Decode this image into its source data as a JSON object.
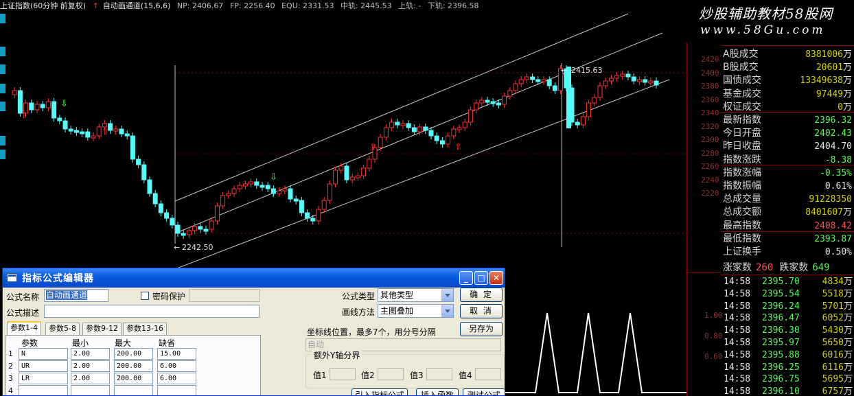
{
  "topbar": {
    "title": "上证指数(60分钟 前复权)",
    "indicator": "自动画通道(15,6,6)",
    "np": "NP: 2406.67",
    "fp": "FP: 2256.40",
    "equ": "EQU: 2331.53",
    "mid": "中轨: 2445.53",
    "upper": "上轨: -",
    "lower": "下轨: 2396.58"
  },
  "watermark": {
    "line1": "炒股辅助教材58股网",
    "line2": "www.58Gu.com"
  },
  "chart": {
    "price_high_label": "2415.63",
    "price_low_label": "2242.50",
    "colors": {
      "up": "#ff3232",
      "down": "#54fcfc",
      "channel": "#c8c8c8",
      "grid": "#8b0000"
    }
  },
  "yaxis": {
    "ticks": [
      "2420",
      "2400",
      "2380",
      "2360",
      "2340",
      "2320",
      "2300",
      "2280",
      "2260",
      "2240",
      "2220"
    ],
    "sub_ticks": [
      "1.00",
      "0.80",
      "0.60"
    ]
  },
  "stats": [
    {
      "label": "A股成交",
      "value": "8381006",
      "unit": "万",
      "color": "#d2d200"
    },
    {
      "label": "B股成交",
      "value": "20601",
      "unit": "万",
      "color": "#d2d200"
    },
    {
      "label": "国债成交",
      "value": "13349638",
      "unit": "万",
      "color": "#d2d200"
    },
    {
      "label": "基金成交",
      "value": "97449",
      "unit": "万",
      "color": "#d2d200"
    },
    {
      "label": "权证成交",
      "value": "0",
      "unit": "万",
      "color": "#d2d200"
    },
    {
      "label": "最新指数",
      "value": "2396.32",
      "unit": "",
      "color": "#54fc54"
    },
    {
      "label": "今日开盘",
      "value": "2402.43",
      "unit": "",
      "color": "#54fc54"
    },
    {
      "label": "昨日收盘",
      "value": "2404.70",
      "unit": "",
      "color": "#e6e6e6"
    },
    {
      "label": "指数涨跌",
      "value": "-8.38",
      "unit": "",
      "color": "#54fc54"
    },
    {
      "label": "指数涨幅",
      "value": "-0.35%",
      "unit": "",
      "color": "#54fc54"
    },
    {
      "label": "指数振幅",
      "value": "0.61%",
      "unit": "",
      "color": "#e6e6e6"
    },
    {
      "label": "总成交量",
      "value": "91228350",
      "unit": "",
      "color": "#d2d200"
    },
    {
      "label": "总成交额",
      "value": "8401607",
      "unit": "万",
      "color": "#d2d200"
    },
    {
      "label": "最高指数",
      "value": "2408.42",
      "unit": "",
      "color": "#ff5050"
    },
    {
      "label": "最低指数",
      "value": "2393.87",
      "unit": "",
      "color": "#54fc54"
    },
    {
      "label": "上证换手",
      "value": "0.50%",
      "unit": "",
      "color": "#e6e6e6"
    }
  ],
  "updown": {
    "up_label": "涨家数",
    "up_value": "260",
    "down_label": "跌家数",
    "down_value": "649"
  },
  "ticks": [
    {
      "time": "14:58",
      "price": "2395.70",
      "vol": "4834",
      "unit": "万"
    },
    {
      "time": "14:58",
      "price": "2395.54",
      "vol": "5518",
      "unit": "万"
    },
    {
      "time": "14:58",
      "price": "2396.24",
      "vol": "5701",
      "unit": "万"
    },
    {
      "time": "14:58",
      "price": "2396.47",
      "vol": "6052",
      "unit": "万"
    },
    {
      "time": "14:58",
      "price": "2396.30",
      "vol": "5430",
      "unit": "万"
    },
    {
      "time": "14:58",
      "price": "2395.97",
      "vol": "5650",
      "unit": "万"
    },
    {
      "time": "14:58",
      "price": "2395.88",
      "vol": "6016",
      "unit": "万"
    },
    {
      "time": "14:58",
      "price": "2396.25",
      "vol": "6116",
      "unit": "万"
    },
    {
      "time": "14:58",
      "price": "2396.75",
      "vol": "5695",
      "unit": "万"
    },
    {
      "time": "14:58",
      "price": "2396.10",
      "vol": "6757",
      "unit": "万"
    }
  ],
  "dialog": {
    "title": "指标公式编辑器",
    "formula_name_label": "公式名称",
    "formula_name_value": "自动画通道",
    "password_label": "密码保护",
    "formula_desc_label": "公式描述",
    "formula_type_label": "公式类型",
    "formula_type_value": "其他类型",
    "draw_method_label": "画线方法",
    "draw_method_value": "主图叠加",
    "ok_label": "确 定",
    "cancel_label": "取 消",
    "save_as_label": "另存为",
    "coord_label": "坐标线位置，最多7个，用分号分隔",
    "coord_placeholder": "自动",
    "extra_y_label": "额外Y轴分界",
    "value_labels": [
      "值1",
      "值2",
      "值3",
      "值4"
    ],
    "tabs": [
      "参数1-4",
      "参数5-8",
      "参数9-12",
      "参数13-16"
    ],
    "grid_headers": [
      "参数",
      "最小",
      "最大",
      "缺省"
    ],
    "params": [
      {
        "row": "1",
        "name": "N",
        "min": "2.00",
        "max": "200.00",
        "default": "15.00"
      },
      {
        "row": "2",
        "name": "UR",
        "min": "2.00",
        "max": "200.00",
        "default": "6.00"
      },
      {
        "row": "3",
        "name": "LR",
        "min": "2.00",
        "max": "200.00",
        "default": "6.00"
      },
      {
        "row": "4",
        "name": "",
        "min": "",
        "max": "",
        "default": ""
      }
    ],
    "bottom_buttons": [
      "引入指标公式",
      "插入函数",
      "测试公式"
    ]
  }
}
